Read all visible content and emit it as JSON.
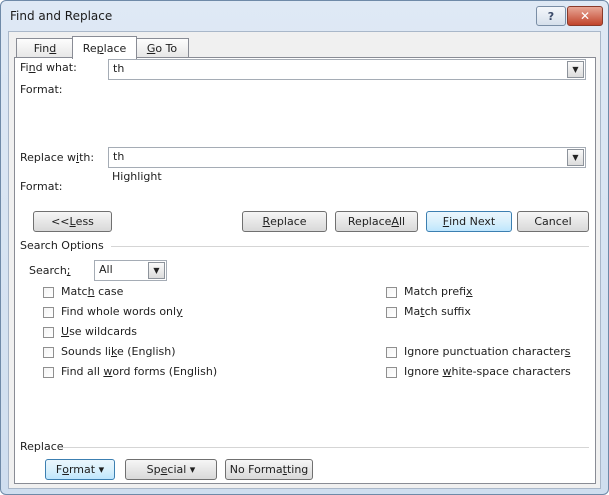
{
  "window": {
    "title": "Find and Replace",
    "help_glyph": "?",
    "close_glyph": "✕"
  },
  "tabs": [
    {
      "pre": "Fin",
      "u": "d",
      "post": ""
    },
    {
      "pre": "Re",
      "u": "p",
      "post": "lace"
    },
    {
      "pre": "",
      "u": "G",
      "post": "o To"
    }
  ],
  "find": {
    "label_pre": "Fi",
    "label_u": "n",
    "label_post": "d what:",
    "value": "th",
    "format_label": "Format:"
  },
  "replace": {
    "label_pre": "Replace w",
    "label_u": "i",
    "label_post": "th:",
    "value": "th",
    "format_label": "Format:",
    "format_value": "Highlight"
  },
  "buttons": {
    "less": {
      "pre": "<< ",
      "u": "L",
      "post": "ess"
    },
    "replace": {
      "pre": "",
      "u": "R",
      "post": "eplace"
    },
    "replace_all": {
      "pre": "Replace ",
      "u": "A",
      "post": "ll"
    },
    "find_next": {
      "pre": "",
      "u": "F",
      "post": "ind Next"
    },
    "cancel": "Cancel"
  },
  "search_options": {
    "title": "Search Options",
    "search_label_pre": "Search",
    "search_label_u": ";",
    "search_value": "All",
    "left": [
      {
        "pre": "Matc",
        "u": "h",
        "post": " case"
      },
      {
        "pre": "Find whole words onl",
        "u": "y",
        "post": ""
      },
      {
        "pre": "",
        "u": "U",
        "post": "se wildcards"
      },
      {
        "pre": "Sounds li",
        "u": "k",
        "post": "e (English)"
      },
      {
        "pre": "Find all ",
        "u": "w",
        "post": "ord forms (English)"
      }
    ],
    "right": [
      {
        "pre": "Match prefi",
        "u": "x",
        "post": ""
      },
      {
        "pre": "Ma",
        "u": "t",
        "post": "ch suffix"
      },
      {
        "pre": "Ignore punctuation character",
        "u": "s",
        "post": ""
      },
      {
        "pre": "Ignore ",
        "u": "w",
        "post": "hite-space characters"
      }
    ]
  },
  "replace_section": {
    "title": "Replace",
    "format_btn": {
      "pre": "F",
      "u": "o",
      "post": "rmat ▾"
    },
    "special_btn": {
      "pre": "Sp",
      "u": "e",
      "post": "cial ▾"
    },
    "no_formatting_btn": {
      "pre": "No Forma",
      "u": "t",
      "post": "ting"
    }
  }
}
